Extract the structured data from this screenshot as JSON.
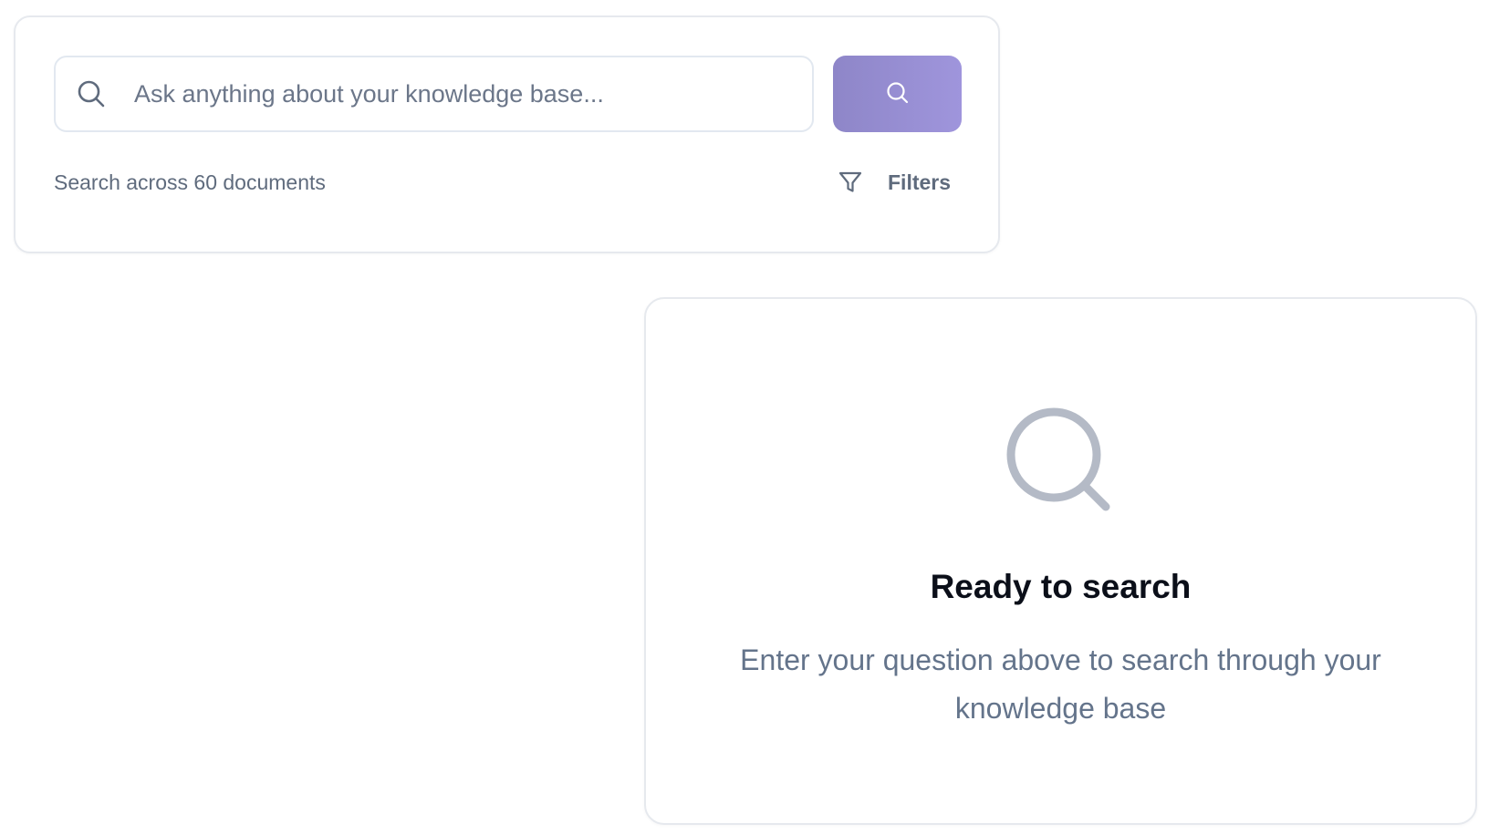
{
  "search": {
    "placeholder": "Ask anything about your knowledge base...",
    "value": "",
    "submit_icon": "search-icon",
    "field_icon": "search-icon",
    "doc_count_text": "Search across 60 documents",
    "filters_label": "Filters",
    "filters_icon": "filter-funnel-icon",
    "button_color_start": "#8e86c8",
    "button_color_end": "#9f95dc"
  },
  "empty_state": {
    "icon": "search-icon",
    "title": "Ready to search",
    "description": "Enter your question above to search through your knowledge base"
  }
}
